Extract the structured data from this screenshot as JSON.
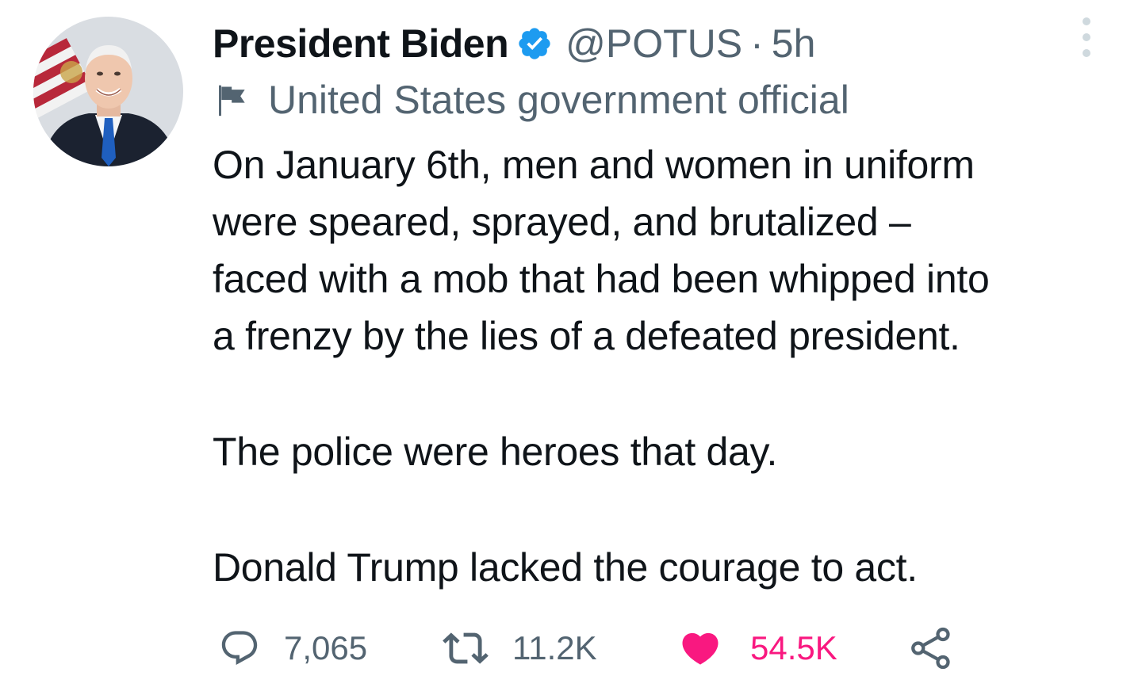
{
  "tweet": {
    "author": {
      "display_name": "President Biden",
      "handle": "@POTUS",
      "separator": "·",
      "time": "5h",
      "verified": true,
      "avatar_icon": "profile-photo"
    },
    "label": {
      "icon": "flag-icon",
      "text": "United States government official"
    },
    "paragraphs": [
      "On January 6th, men and women in uniform\nwere speared, sprayed, and brutalized –\nfaced with a mob that had been whipped into\na frenzy by the lies of a defeated president.",
      "The police were heroes that day.",
      "Donald Trump lacked the courage to act."
    ],
    "actions": {
      "reply": {
        "icon": "reply-icon",
        "count": "7,065"
      },
      "retweet": {
        "icon": "retweet-icon",
        "count": "11.2K"
      },
      "like": {
        "icon": "heart-icon",
        "count": "54.5K",
        "liked": true
      },
      "share": {
        "icon": "share-icon"
      }
    }
  },
  "colors": {
    "text_primary": "#0f1419",
    "text_secondary": "#536471",
    "verified_blue": "#1d9bf0",
    "like_pink": "#f91880"
  }
}
